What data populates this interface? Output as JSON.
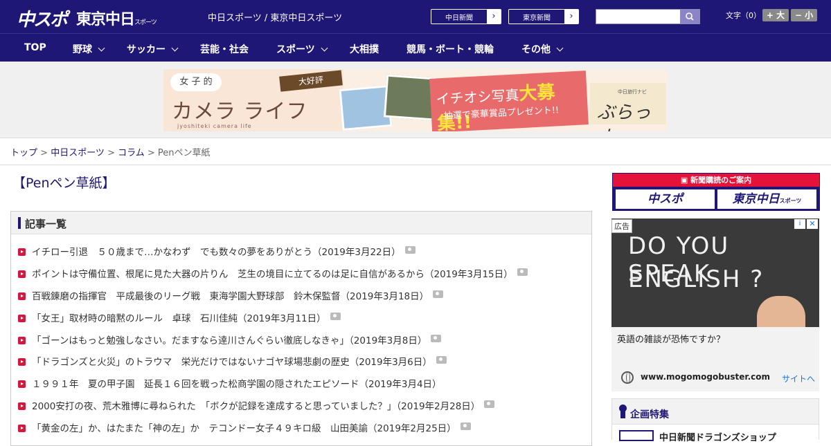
{
  "header": {
    "logo_chunichi_sports": "中スポ",
    "logo_tokyo_chunichi": "東京中日",
    "logo_tokyo_suffix": "スポーツ",
    "subtitle": "中日スポーツ / 東京中日スポーツ",
    "link_chunichi_shimbun": "中日新聞",
    "link_tokyo_shimbun": "東京新聞",
    "search_placeholder": "",
    "font_size_label": "文字（0）",
    "font_bigger": "+ 大",
    "font_smaller": "− 小",
    "colors": {
      "primary": "#1f1775",
      "accent_red": "#d3173d"
    }
  },
  "nav": {
    "items": [
      {
        "label": "TOP",
        "has_dropdown": false
      },
      {
        "label": "野球",
        "has_dropdown": true
      },
      {
        "label": "サッカー",
        "has_dropdown": true
      },
      {
        "label": "芸能・社会",
        "has_dropdown": false
      },
      {
        "label": "スポーツ",
        "has_dropdown": true
      },
      {
        "label": "大相撲",
        "has_dropdown": false
      },
      {
        "label": "競馬・ボート・競輪",
        "has_dropdown": false
      },
      {
        "label": "その他",
        "has_dropdown": true
      }
    ]
  },
  "banner": {
    "joshi": "女 子 的",
    "kamera": "カメラ ライフ",
    "kamera_sub": "jyoshiteki camera life",
    "daikohyo": "大好評",
    "ichioshi": "イチオシ写真",
    "daiboshu": "大募集!!",
    "present": "抽選で豪華賞品プレゼント!!",
    "burattto_sub": "中日旅行ナビ",
    "burattto": "ぶらっ人"
  },
  "breadcrumb": [
    {
      "label": "トップ",
      "link": true
    },
    {
      "label": "中日スポーツ",
      "link": true
    },
    {
      "label": "コラム",
      "link": true
    },
    {
      "label": "Penペン草紙",
      "link": false
    }
  ],
  "main": {
    "title": "【Penペン草紙】",
    "list_heading": "記事一覧",
    "articles": [
      {
        "text": "イチロー引退　５０歳まで…かなわず　でも数々の夢をありがとう（2019年3月22日）",
        "has_photo": true
      },
      {
        "text": "ポイントは守備位置、根尾に見た大器の片りん　芝生の境目に立てるのは足に自信があるから（2019年3月15日）",
        "has_photo": true
      },
      {
        "text": "百戦錬磨の指揮官　平成最後のリーグ戦　東海学園大野球部　鈴木保監督（2019年3月18日）",
        "has_photo": true
      },
      {
        "text": "「女王」取材時の暗黙のルール　卓球　石川佳純（2019年3月11日）",
        "has_photo": true
      },
      {
        "text": "「ゴーンはもっと勉強しなさい。だますなら逹川さんぐらい徹底しなきゃ」（2019年3月8日）",
        "has_photo": true
      },
      {
        "text": "「ドラゴンズと火災」のトラウマ　栄光だけではないナゴヤ球場悲劇の歴史（2019年3月6日）",
        "has_photo": true
      },
      {
        "text": "１９９１年　夏の甲子園　延長１６回を戦った松商学園の隠されたエピソード（2019年3月4日）",
        "has_photo": false
      },
      {
        "text": "2000安打の夜、荒木雅博に尋ねられた　「ボクが記録を達成すると思っていました？」（2019年2月28日）",
        "has_photo": true
      },
      {
        "text": "「黄金の左」か、はたまた「神の左」か　テコンドー女子４９キロ級　山田美諭（2019年2月25日）",
        "has_photo": true
      }
    ]
  },
  "sidebar": {
    "subscription_heading": "新聞購読のご案内",
    "subscription_chusupo": "中スポ",
    "subscription_tokyo": "東京中日",
    "subscription_tokyo_suffix": "スポーツ",
    "ad": {
      "label": "広告",
      "image_text_line1": "DO YOU SPEAK",
      "image_text_line2": "ENGLISH ?",
      "question": "英語の雑談が恐怖ですか？",
      "url": "www.mogomogobuster.com",
      "visit": "サイトへ",
      "info": "i",
      "close": "✕"
    },
    "kikaku_heading": "企画特集",
    "kikaku_item": "中日新聞ドラゴンズショップ"
  }
}
